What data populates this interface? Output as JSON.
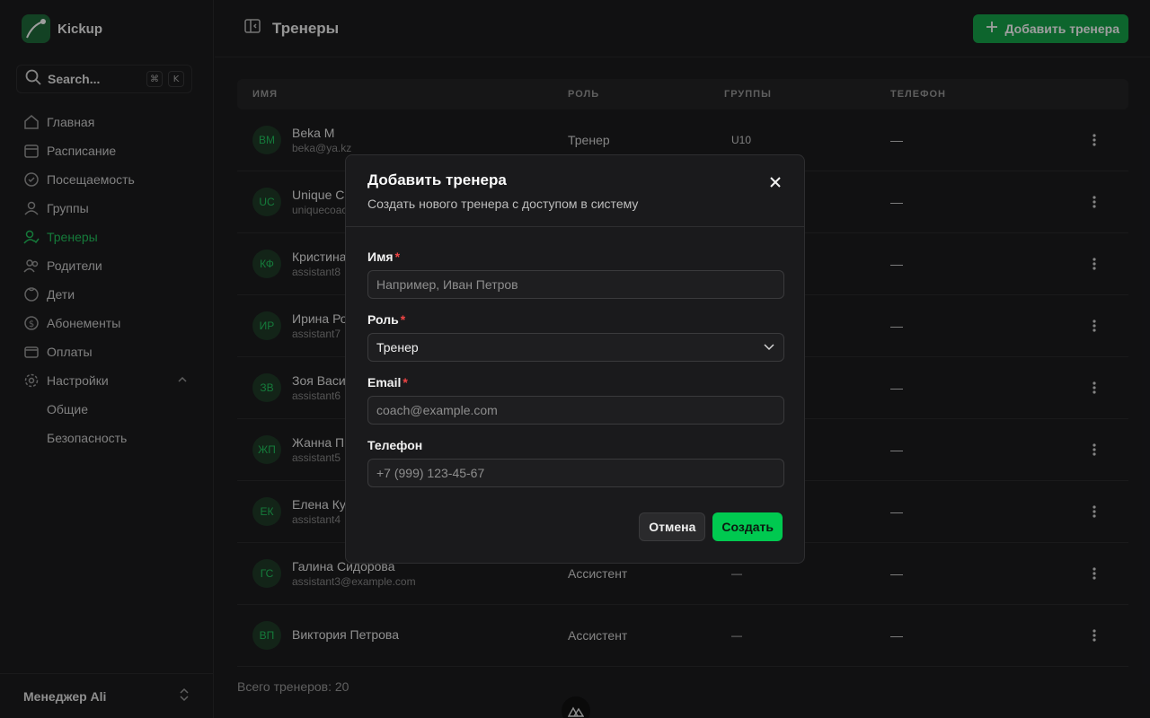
{
  "brand": {
    "name": "Kickup"
  },
  "search": {
    "label": "Search...",
    "kbd1": "⌘",
    "kbd2": "K"
  },
  "sidebar": {
    "items": [
      {
        "label": "Главная"
      },
      {
        "label": "Расписание"
      },
      {
        "label": "Посещаемость"
      },
      {
        "label": "Группы"
      },
      {
        "label": "Тренеры"
      },
      {
        "label": "Родители"
      },
      {
        "label": "Дети"
      },
      {
        "label": "Абонементы"
      },
      {
        "label": "Оплаты"
      },
      {
        "label": "Настройки"
      }
    ],
    "sub": [
      {
        "label": "Общие"
      },
      {
        "label": "Безопасность"
      }
    ],
    "user": "Менеджер Ali"
  },
  "header": {
    "title": "Тренеры",
    "add_label": "Добавить тренера"
  },
  "table": {
    "columns": [
      "ИМЯ",
      "РОЛЬ",
      "ГРУППЫ",
      "ТЕЛЕФОН"
    ],
    "rows": [
      {
        "initials": "BM",
        "name": "Beka M",
        "email": "beka@ya.kz",
        "role": "Тренер",
        "groups": "U10",
        "phone": "—"
      },
      {
        "initials": "UC",
        "name": "Unique C",
        "email": "uniquecoac",
        "role": "",
        "groups": "",
        "phone": "—"
      },
      {
        "initials": "КФ",
        "name": "Кристина",
        "email": "assistant8",
        "role": "",
        "groups": "",
        "phone": "—"
      },
      {
        "initials": "ИР",
        "name": "Ирина Ро",
        "email": "assistant7",
        "role": "",
        "groups": "",
        "phone": "—"
      },
      {
        "initials": "ЗВ",
        "name": "Зоя Васи",
        "email": "assistant6",
        "role": "",
        "groups": "",
        "phone": "—"
      },
      {
        "initials": "ЖП",
        "name": "Жанна П",
        "email": "assistant5",
        "role": "",
        "groups": "",
        "phone": "—"
      },
      {
        "initials": "ЕК",
        "name": "Елена Ку",
        "email": "assistant4",
        "role": "",
        "groups": "",
        "phone": "—"
      },
      {
        "initials": "ГС",
        "name": "Галина Сидорова",
        "email": "assistant3@example.com",
        "role": "Ассистент",
        "groups": "—",
        "phone": "—"
      },
      {
        "initials": "ВП",
        "name": "Виктория Петрова",
        "email": "",
        "role": "Ассистент",
        "groups": "—",
        "phone": "—"
      }
    ],
    "total": "Всего тренеров: 20"
  },
  "modal": {
    "title": "Добавить тренера",
    "subtitle": "Создать нового тренера с доступом в систему",
    "name_label": "Имя",
    "name_placeholder": "Например, Иван Петров",
    "role_label": "Роль",
    "role_value": "Тренер",
    "email_label": "Email",
    "email_placeholder": "coach@example.com",
    "phone_label": "Телефон",
    "phone_placeholder": "+7 (999) 123-45-67",
    "required_mark": "*",
    "cancel": "Отмена",
    "create": "Создать"
  }
}
